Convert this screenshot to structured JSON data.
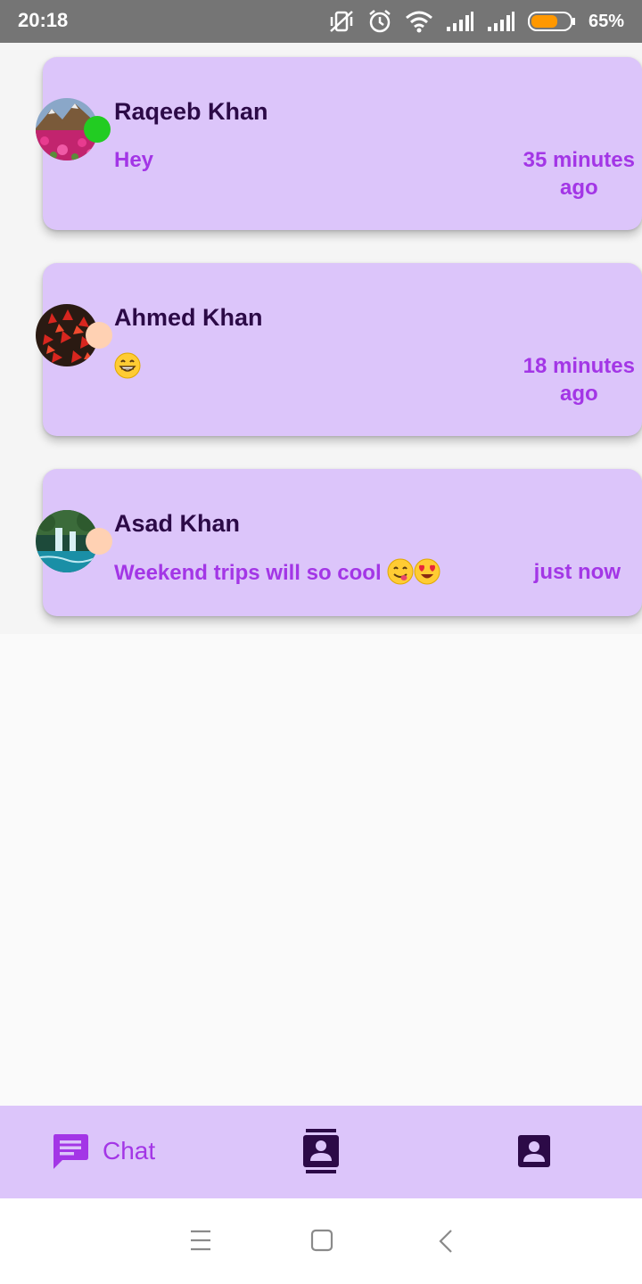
{
  "status_bar": {
    "time": "20:18",
    "battery_percent": "65%",
    "battery_level": 0.65,
    "battery_color": "#ff9800",
    "icons": [
      "vibrate-off-icon",
      "alarm-icon",
      "wifi-icon",
      "signal-icon",
      "signal-icon",
      "battery-icon"
    ]
  },
  "chats": [
    {
      "name": "Raqeeb Khan",
      "message": "Hey",
      "time_line1": "35 minutes",
      "time_line2": "ago",
      "online": true,
      "presence_color": "#22cc22",
      "avatar": "mountain-flower-field-photo"
    },
    {
      "name": "Ahmed Khan",
      "message": "",
      "message_emoji": "grinning-face-emoji",
      "time_line1": "18 minutes",
      "time_line2": "ago",
      "online": false,
      "presence_color": "#ffd1b3",
      "avatar": "red-leaves-photo"
    },
    {
      "name": "Asad Khan",
      "message": "Weekend trips will so cool",
      "message_emojis": [
        "yum-face-emoji",
        "heart-eyes-emoji"
      ],
      "time_line1": "just now",
      "online": false,
      "presence_color": "#ffd1b3",
      "avatar": "waterfall-photo"
    }
  ],
  "bottom_nav": {
    "chat_label": "Chat",
    "active_color": "#a336e6",
    "inactive_color": "#2c0a47",
    "icons": [
      "chat-icon",
      "contacts-icon",
      "profile-icon"
    ]
  },
  "colors": {
    "card": "#dcc5fa",
    "name": "#2c0a47",
    "accent": "#a336e6",
    "status_bar": "#757575"
  }
}
